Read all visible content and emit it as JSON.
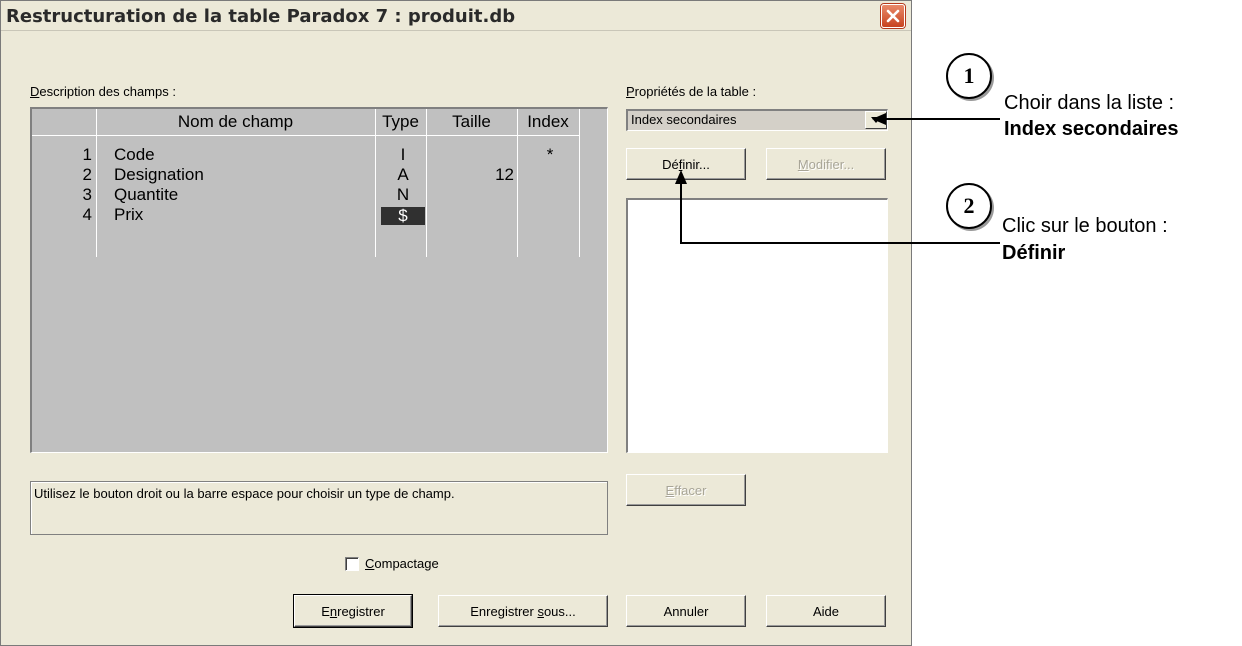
{
  "window": {
    "title": "Restructuration de la table Paradox 7 : produit.db"
  },
  "fields": {
    "label_prefix": "D",
    "label_rest": "escription des champs :",
    "headers": {
      "num": "",
      "name": "Nom de champ",
      "type": "Type",
      "size": "Taille",
      "index": "Index"
    },
    "rows": [
      {
        "num": "1",
        "name": "Code",
        "type": "I",
        "size": "",
        "index": "*"
      },
      {
        "num": "2",
        "name": "Designation",
        "type": "A",
        "size": "12",
        "index": ""
      },
      {
        "num": "3",
        "name": "Quantite",
        "type": "N",
        "size": "",
        "index": ""
      },
      {
        "num": "4",
        "name": "Prix",
        "type": "$",
        "size": "",
        "index": ""
      }
    ]
  },
  "status": {
    "text": "Utilisez le bouton droit ou la barre espace pour choisir un type de champ."
  },
  "properties": {
    "label_prefix": "P",
    "label_rest": "ropriétés de la table :",
    "selected": "Index secondaires",
    "define_button_a": "Dé",
    "define_button_u": "f",
    "define_button_b": "inir...",
    "modify_button_u": "M",
    "modify_button_b": "odifier...",
    "erase_button_u": "E",
    "erase_button_b": "ffacer"
  },
  "compact": {
    "label_u": "C",
    "label_rest": "ompactage",
    "checked": false
  },
  "buttons": {
    "save_a": "E",
    "save_u": "n",
    "save_b": "registrer",
    "save_as_a": "Enregistrer ",
    "save_as_u": "s",
    "save_as_b": "ous...",
    "cancel": "Annuler",
    "help": "Aide"
  },
  "annotations": {
    "step1": {
      "number": "1",
      "line1": "Choir dans la liste :",
      "line2": "Index secondaires"
    },
    "step2": {
      "number": "2",
      "line1": "Clic sur le bouton :",
      "line2": "Définir"
    }
  }
}
